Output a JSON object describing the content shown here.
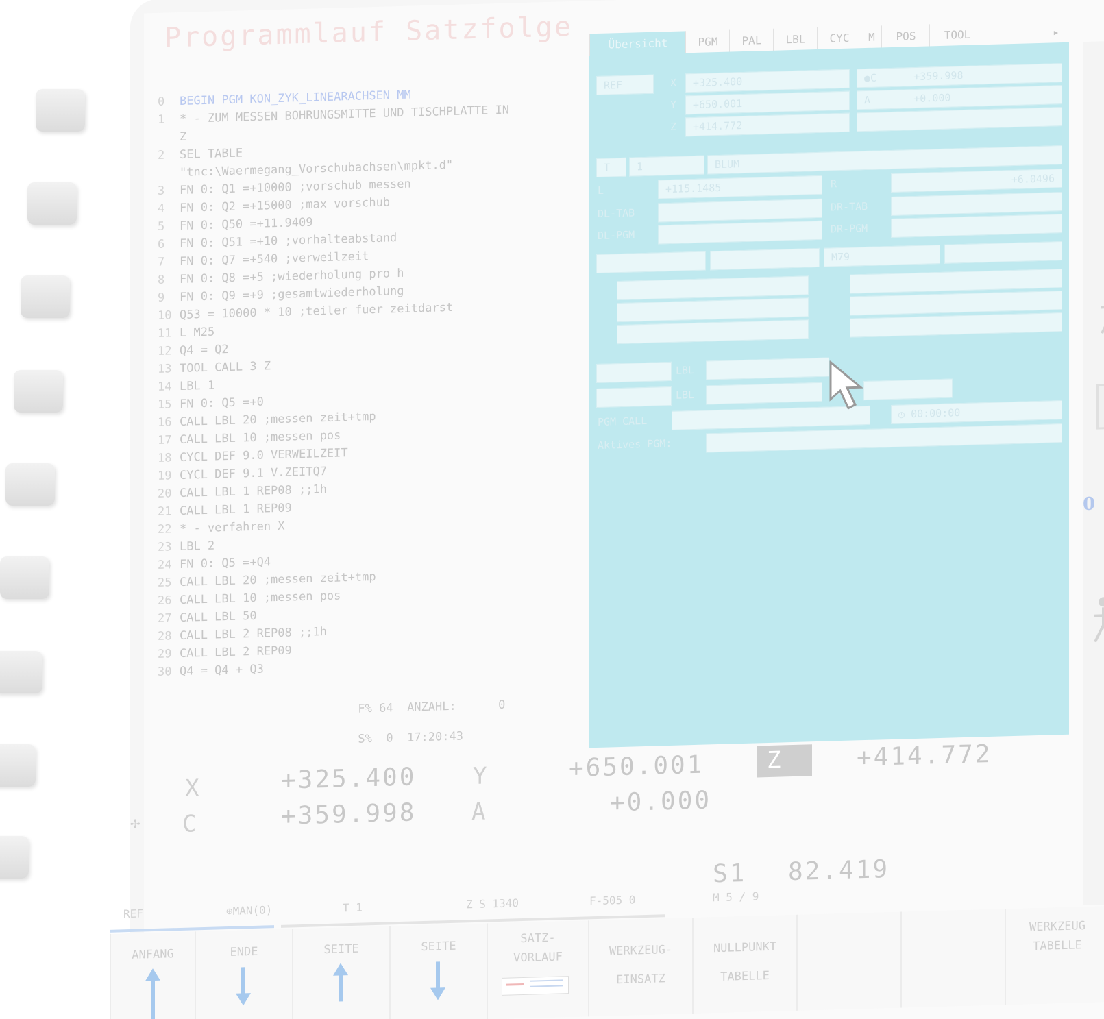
{
  "window": {
    "title": "Programmlauf Satzfolge"
  },
  "tabs": [
    "Übersicht",
    "PGM",
    "PAL",
    "LBL",
    "CYC",
    "M",
    "POS",
    "TOOL"
  ],
  "program": {
    "lines": [
      {
        "n": "0",
        "text": "BEGIN PGM KON_ZYK_LINEARACHSEN MM"
      },
      {
        "n": "1",
        "text": "* - ZUM MESSEN BOHRUNGSMITTE UND TISCHPLATTE IN"
      },
      {
        "n": "",
        "text": "Z"
      },
      {
        "n": "2",
        "text": "SEL TABLE"
      },
      {
        "n": "",
        "text": "\"tnc:\\Waermegang_Vorschubachsen\\mpkt.d\""
      },
      {
        "n": "3",
        "text": "FN 0: Q1 =+10000 ;vorschub messen"
      },
      {
        "n": "4",
        "text": "FN 0: Q2 =+15000 ;max vorschub"
      },
      {
        "n": "5",
        "text": "FN 0: Q50 =+11.9409"
      },
      {
        "n": "6",
        "text": "FN 0: Q51 =+10 ;vorhalteabstand"
      },
      {
        "n": "7",
        "text": "FN 0: Q7 =+540 ;verweilzeit"
      },
      {
        "n": "8",
        "text": "FN 0: Q8 =+5 ;wiederholung pro h"
      },
      {
        "n": "9",
        "text": "FN 0: Q9 =+9 ;gesamtwiederholung"
      },
      {
        "n": "10",
        "text": "Q53 = 10000 * 10 ;teiler fuer zeitdarst"
      },
      {
        "n": "11",
        "text": "L M25"
      },
      {
        "n": "12",
        "text": "Q4 = Q2"
      },
      {
        "n": "13",
        "text": "TOOL CALL 3 Z"
      },
      {
        "n": "14",
        "text": "LBL 1"
      },
      {
        "n": "15",
        "text": "FN 0: Q5 =+0"
      },
      {
        "n": "16",
        "text": "CALL LBL 20 ;messen zeit+tmp"
      },
      {
        "n": "17",
        "text": "CALL LBL 10 ;messen pos"
      },
      {
        "n": "18",
        "text": "CYCL DEF 9.0 VERWEILZEIT"
      },
      {
        "n": "19",
        "text": "CYCL DEF 9.1 V.ZEITQ7"
      },
      {
        "n": "20",
        "text": "CALL LBL 1 REP08 ;;1h"
      },
      {
        "n": "21",
        "text": "CALL LBL 1 REP09"
      },
      {
        "n": "22",
        "text": "* - verfahren X"
      },
      {
        "n": "23",
        "text": "LBL 2"
      },
      {
        "n": "24",
        "text": "FN 0: Q5 =+Q4"
      },
      {
        "n": "25",
        "text": "CALL LBL 20 ;messen zeit+tmp"
      },
      {
        "n": "26",
        "text": "CALL LBL 10 ;messen pos"
      },
      {
        "n": "27",
        "text": "CALL LBL 50"
      },
      {
        "n": "28",
        "text": "CALL LBL 2 REP08 ;;1h"
      },
      {
        "n": "29",
        "text": "CALL LBL 2 REP09"
      },
      {
        "n": "30",
        "text": "Q4 = Q4 + Q3"
      }
    ],
    "footer": {
      "f_label": "F%",
      "f_value": "64",
      "anzahl_label": "ANZAHL:",
      "anzahl_value": "0",
      "s_label": "S%",
      "s_value": "0",
      "clock": "17:20:43"
    }
  },
  "status_panel": {
    "ref_label": "REF",
    "x_label": "X",
    "x_value": "+325.400",
    "y_label": "Y",
    "y_value": "+650.001",
    "z_label": "Z",
    "z_value": "+414.772",
    "c_label": "●C",
    "c_value": "+359.998",
    "a_label": "A",
    "a_value": "+0.000",
    "t_label": "T",
    "t_value": "1",
    "tool_name": "BLUM",
    "l_label": "L",
    "l_value": "+115.1485",
    "r_label": "R",
    "r_value": "+6.0496",
    "dl_tab_label": "DL-TAB",
    "dr_tab_label": "DR-TAB",
    "dl_pgm_label": "DL-PGM",
    "dr_pgm_label": "DR-PGM",
    "m_value": "M79",
    "lbl_label": "LBL",
    "lbl2_label": "LBL",
    "rep_label": "REP",
    "timer": "00:00:00",
    "pgm_call_label": "PGM CALL",
    "active_pgm_label": "Aktives PGM:"
  },
  "positions": {
    "x_label": "X",
    "x_value": "+325.400",
    "y_label": "Y",
    "y_value": "+650.001",
    "z_label": "Z",
    "z_value": "+414.772",
    "c_label": "C",
    "c_value": "+359.998",
    "a_label": "A",
    "a_value": "+0.000",
    "s1_label": "S1",
    "s1_value": "82.419"
  },
  "status_bar": {
    "ref": "REF",
    "man": "MAN(0)",
    "t": "T 1",
    "zs": "Z S 1340",
    "f": "F-505 0",
    "m": "M 5 / 9"
  },
  "softkeys": {
    "anfang": "ANFANG",
    "ende": "ENDE",
    "seite_up": "SEITE",
    "seite_down": "SEITE",
    "satzvorlauf_1": "SATZ-",
    "satzvorlauf_2": "VORLAUF",
    "werkzeug_einsatz_1": "WERKZEUG-",
    "werkzeug_einsatz_2": "EINSATZ",
    "nullpunkt_1": "NULLPUNKT",
    "nullpunkt_2": "TABELLE",
    "werkzeug_tabelle_1": "WERKZEUG",
    "werkzeug_tabelle_2": "TABELLE"
  },
  "colors": {
    "panel_bg": "#bfe9ef",
    "arrow_blue": "#a6c9ee",
    "title_red": "#f4dede"
  }
}
